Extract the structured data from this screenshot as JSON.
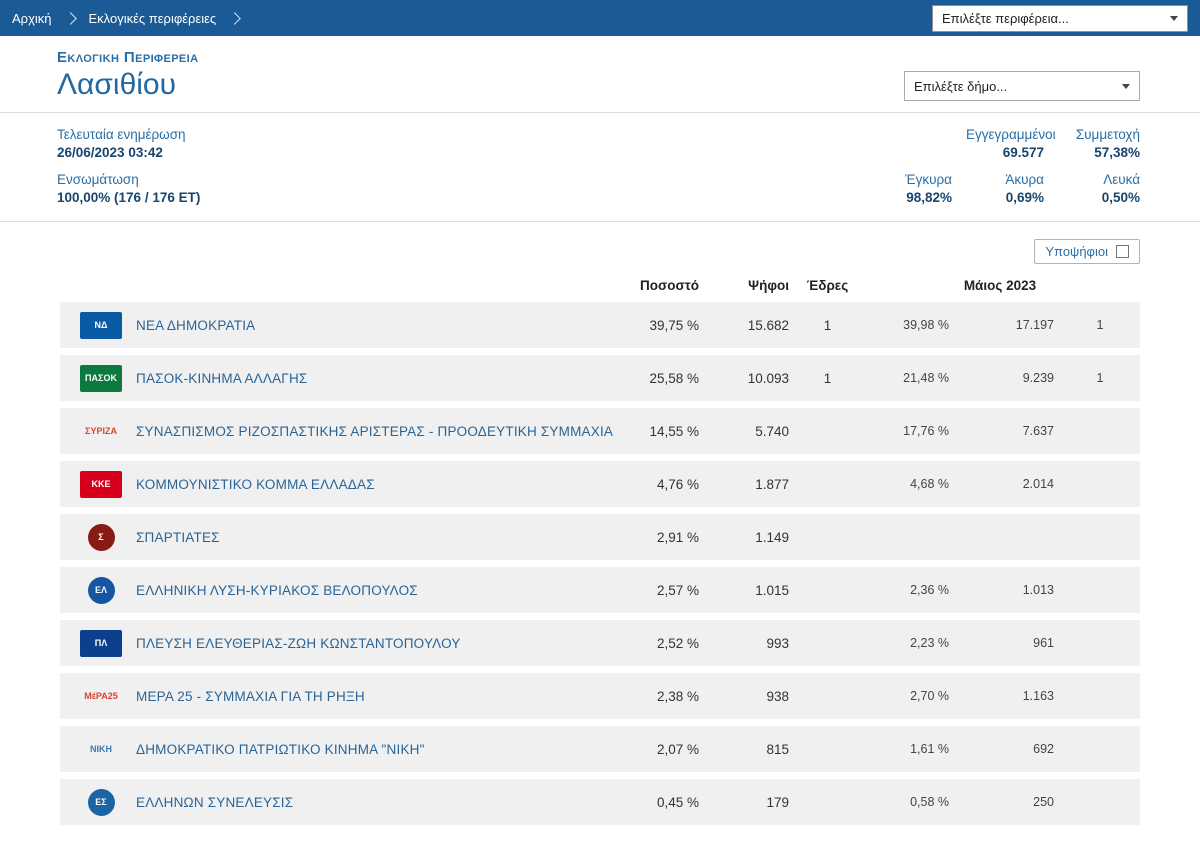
{
  "breadcrumb": {
    "home": "Αρχική",
    "section": "Εκλογικές περιφέρειες",
    "region_select_value": "Επιλέξτε περιφέρεια..."
  },
  "header": {
    "kicker": "Εκλογική Περιφέρεια",
    "title": "Λασιθίου",
    "municipality_select_value": "Επιλέξτε δήμο..."
  },
  "stats": {
    "last_update": {
      "label": "Τελευταία ενημέρωση",
      "value": "26/06/2023 03:42"
    },
    "integration": {
      "label": "Ενσωμάτωση",
      "value": "100,00% (176 / 176 ΕΤ)"
    },
    "registered": {
      "label": "Εγγεγραμμένοι",
      "value": "69.577"
    },
    "turnout": {
      "label": "Συμμετοχή",
      "value": "57,38%"
    },
    "valid": {
      "label": "Έγκυρα",
      "value": "98,82%"
    },
    "invalid": {
      "label": "Άκυρα",
      "value": "0,69%"
    },
    "blank": {
      "label": "Λευκά",
      "value": "0,50%"
    }
  },
  "table": {
    "candidates_button_label": "Υποψήφιοι",
    "headers": {
      "percent": "Ποσοστό",
      "votes": "Ψήφοι",
      "seats": "Έδρες",
      "previous": "Μάιος 2023"
    },
    "rows": [
      {
        "party": "ΝΕΑ ΔΗΜΟΚΡΑΤΙΑ",
        "pct": "39,75 %",
        "votes": "15.682",
        "seats": "1",
        "prev_pct": "39,98 %",
        "prev_votes": "17.197",
        "prev_seats": "1",
        "logo": {
          "text": "ΝΔ",
          "bg": "#0a5aa4",
          "fg": "#ffffff",
          "shape": "rect"
        }
      },
      {
        "party": "ΠΑΣΟΚ-ΚΙΝΗΜΑ ΑΛΛΑΓΗΣ",
        "pct": "25,58 %",
        "votes": "10.093",
        "seats": "1",
        "prev_pct": "21,48 %",
        "prev_votes": "9.239",
        "prev_seats": "1",
        "logo": {
          "text": "ΠΑΣΟΚ",
          "bg": "#0c7a3f",
          "fg": "#ffffff",
          "shape": "rect"
        }
      },
      {
        "party": "ΣΥΝΑΣΠΙΣΜΟΣ ΡΙΖΟΣΠΑΣΤΙΚΗΣ ΑΡΙΣΤΕΡΑΣ - ΠΡΟΟΔΕΥΤΙΚΗ ΣΥΜΜΑΧΙΑ",
        "pct": "14,55 %",
        "votes": "5.740",
        "seats": "",
        "prev_pct": "17,76 %",
        "prev_votes": "7.637",
        "prev_seats": "",
        "logo": {
          "text": "ΣΥΡΙΖΑ",
          "bg": "transparent",
          "fg": "#e0432d",
          "shape": "rect"
        }
      },
      {
        "party": "ΚΟΜΜΟΥΝΙΣΤΙΚΟ ΚΟΜΜΑ ΕΛΛΑΔΑΣ",
        "pct": "4,76 %",
        "votes": "1.877",
        "seats": "",
        "prev_pct": "4,68 %",
        "prev_votes": "2.014",
        "prev_seats": "",
        "logo": {
          "text": "ΚΚΕ",
          "bg": "#d6001c",
          "fg": "#ffffff",
          "shape": "rect"
        }
      },
      {
        "party": "ΣΠΑΡΤΙΑΤΕΣ",
        "pct": "2,91 %",
        "votes": "1.149",
        "seats": "",
        "prev_pct": "",
        "prev_votes": "",
        "prev_seats": "",
        "logo": {
          "text": "Σ",
          "bg": "#8a1a14",
          "fg": "#ffffff",
          "shape": "circle"
        }
      },
      {
        "party": "ΕΛΛΗΝΙΚΗ ΛΥΣΗ-ΚΥΡΙΑΚΟΣ ΒΕΛΟΠΟΥΛΟΣ",
        "pct": "2,57 %",
        "votes": "1.015",
        "seats": "",
        "prev_pct": "2,36 %",
        "prev_votes": "1.013",
        "prev_seats": "",
        "logo": {
          "text": "ΕΛ",
          "bg": "#14569f",
          "fg": "#ffffff",
          "shape": "circle"
        }
      },
      {
        "party": "ΠΛΕΥΣΗ ΕΛΕΥΘΕΡΙΑΣ-ΖΩΗ ΚΩΝΣΤΑΝΤΟΠΟΥΛΟΥ",
        "pct": "2,52 %",
        "votes": "993",
        "seats": "",
        "prev_pct": "2,23 %",
        "prev_votes": "961",
        "prev_seats": "",
        "logo": {
          "text": "ΠΛ",
          "bg": "#0e3f8c",
          "fg": "#ffffff",
          "shape": "rect"
        }
      },
      {
        "party": "ΜΕΡΑ 25 - ΣΥΜΜΑΧΙΑ ΓΙΑ ΤΗ ΡΗΞΗ",
        "pct": "2,38 %",
        "votes": "938",
        "seats": "",
        "prev_pct": "2,70 %",
        "prev_votes": "1.163",
        "prev_seats": "",
        "logo": {
          "text": "ΜέΡΑ25",
          "bg": "transparent",
          "fg": "#d8452e",
          "shape": "rect"
        }
      },
      {
        "party": "ΔΗΜΟΚΡΑΤΙΚΟ ΠΑΤΡΙΩΤΙΚΟ ΚΙΝΗΜΑ \"ΝΙΚΗ\"",
        "pct": "2,07 %",
        "votes": "815",
        "seats": "",
        "prev_pct": "1,61 %",
        "prev_votes": "692",
        "prev_seats": "",
        "logo": {
          "text": "ΝΙΚΗ",
          "bg": "transparent",
          "fg": "#3a7abf",
          "shape": "rect"
        }
      },
      {
        "party": "ΕΛΛΗΝΩΝ ΣΥΝΕΛΕΥΣΙΣ",
        "pct": "0,45 %",
        "votes": "179",
        "seats": "",
        "prev_pct": "0,58 %",
        "prev_votes": "250",
        "prev_seats": "",
        "logo": {
          "text": "ΕΣ",
          "bg": "#1c63a5",
          "fg": "#ffffff",
          "shape": "circle"
        }
      }
    ]
  }
}
